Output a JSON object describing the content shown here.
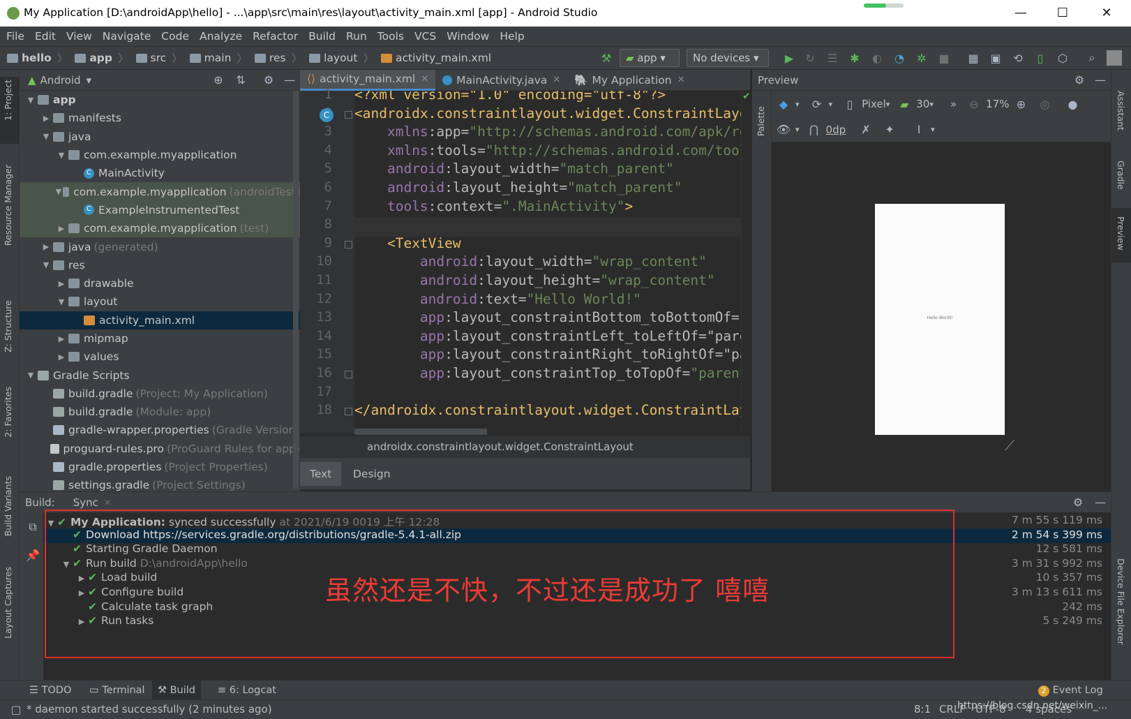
{
  "window": {
    "title": "My Application [D:\\androidApp\\hello] - ...\\app\\src\\main\\res\\layout\\activity_main.xml [app] - Android Studio",
    "minimize": "—",
    "maximize": "☐",
    "close": "✕"
  },
  "menu": [
    "File",
    "Edit",
    "View",
    "Navigate",
    "Code",
    "Analyze",
    "Refactor",
    "Build",
    "Run",
    "Tools",
    "VCS",
    "Window",
    "Help"
  ],
  "breadcrumbs": [
    "hello",
    "app",
    "src",
    "main",
    "res",
    "layout",
    "activity_main.xml"
  ],
  "toolbar": {
    "config": "app",
    "devices": "No devices"
  },
  "left_stripe": [
    "1: Project",
    "Resource Manager",
    "Z: Structure",
    "2: Favorites",
    "Build Variants",
    "Layout Captures"
  ],
  "right_stripe": [
    "Assistant",
    "Gradle",
    "Preview",
    "Device File Explorer"
  ],
  "project": {
    "view": "Android",
    "tree": [
      {
        "label": "app",
        "depth": 0,
        "arrow": "▼",
        "icon": "folder",
        "bold": true
      },
      {
        "label": "manifests",
        "depth": 1,
        "arrow": "▶",
        "icon": "folder"
      },
      {
        "label": "java",
        "depth": 1,
        "arrow": "▼",
        "icon": "folder"
      },
      {
        "label": "com.example.myapplication",
        "depth": 2,
        "arrow": "▼",
        "icon": "package"
      },
      {
        "label": "MainActivity",
        "depth": 3,
        "arrow": "",
        "icon": "class"
      },
      {
        "label": "com.example.myapplication",
        "hint": "(androidTest)",
        "depth": 2,
        "arrow": "▼",
        "icon": "package",
        "tint": true
      },
      {
        "label": "ExampleInstrumentedTest",
        "depth": 3,
        "arrow": "",
        "icon": "class",
        "tint": true
      },
      {
        "label": "com.example.myapplication",
        "hint": "(test)",
        "depth": 2,
        "arrow": "▶",
        "icon": "package",
        "tint": true
      },
      {
        "label": "java",
        "hint": "(generated)",
        "depth": 1,
        "arrow": "▶",
        "icon": "folder"
      },
      {
        "label": "res",
        "depth": 1,
        "arrow": "▼",
        "icon": "folder"
      },
      {
        "label": "drawable",
        "depth": 2,
        "arrow": "▶",
        "icon": "folder"
      },
      {
        "label": "layout",
        "depth": 2,
        "arrow": "▼",
        "icon": "folder"
      },
      {
        "label": "activity_main.xml",
        "depth": 3,
        "arrow": "",
        "icon": "xml",
        "selected": true
      },
      {
        "label": "mipmap",
        "depth": 2,
        "arrow": "▶",
        "icon": "folder"
      },
      {
        "label": "values",
        "depth": 2,
        "arrow": "▶",
        "icon": "folder"
      },
      {
        "label": "Gradle Scripts",
        "depth": 0,
        "arrow": "▼",
        "icon": "gradle"
      },
      {
        "label": "build.gradle",
        "hint": "(Project: My Application)",
        "depth": 1,
        "arrow": "",
        "icon": "gradle"
      },
      {
        "label": "build.gradle",
        "hint": "(Module: app)",
        "depth": 1,
        "arrow": "",
        "icon": "gradle"
      },
      {
        "label": "gradle-wrapper.properties",
        "hint": "(Gradle Version)",
        "depth": 1,
        "arrow": "",
        "icon": "props"
      },
      {
        "label": "proguard-rules.pro",
        "hint": "(ProGuard Rules for app)",
        "depth": 1,
        "arrow": "",
        "icon": "file"
      },
      {
        "label": "gradle.properties",
        "hint": "(Project Properties)",
        "depth": 1,
        "arrow": "",
        "icon": "props"
      },
      {
        "label": "settings.gradle",
        "hint": "(Project Settings)",
        "depth": 1,
        "arrow": "",
        "icon": "gradle"
      }
    ]
  },
  "editor_tabs": [
    {
      "label": "activity_main.xml",
      "active": true
    },
    {
      "label": "MainActivity.java",
      "active": false
    },
    {
      "label": "My Application",
      "active": false
    }
  ],
  "code_lines": [
    {
      "n": "1",
      "parts": [
        [
          "t-pi",
          "<?xml version=\"1.0\" encoding=\"utf-8\"?>"
        ]
      ]
    },
    {
      "n": "2",
      "parts": [
        [
          "t-tag",
          "<androidx.constraintlayout.widget.ConstraintLayout"
        ]
      ]
    },
    {
      "n": "3",
      "parts": [
        [
          "t-attr",
          "    "
        ],
        [
          "t-ns",
          "xmlns"
        ],
        [
          "t-attr",
          ":app="
        ],
        [
          "t-val",
          "\"http://schemas.android.com/apk/res-auto\""
        ]
      ]
    },
    {
      "n": "4",
      "parts": [
        [
          "t-attr",
          "    "
        ],
        [
          "t-ns",
          "xmlns"
        ],
        [
          "t-attr",
          ":tools="
        ],
        [
          "t-val",
          "\"http://schemas.android.com/tools\""
        ]
      ]
    },
    {
      "n": "5",
      "parts": [
        [
          "t-attr",
          "    "
        ],
        [
          "t-ns",
          "android"
        ],
        [
          "t-attr",
          ":layout_width="
        ],
        [
          "t-val",
          "\"match_parent\""
        ]
      ]
    },
    {
      "n": "6",
      "parts": [
        [
          "t-attr",
          "    "
        ],
        [
          "t-ns",
          "android"
        ],
        [
          "t-attr",
          ":layout_height="
        ],
        [
          "t-val",
          "\"match_parent\""
        ]
      ]
    },
    {
      "n": "7",
      "parts": [
        [
          "t-attr",
          "    "
        ],
        [
          "t-ns",
          "tools"
        ],
        [
          "t-attr",
          ":context="
        ],
        [
          "t-val",
          "\".MainActivity\""
        ],
        [
          "t-tag",
          ">"
        ]
      ]
    },
    {
      "n": "8",
      "parts": []
    },
    {
      "n": "9",
      "parts": [
        [
          "t-attr",
          "    "
        ],
        [
          "t-tag",
          "<TextView"
        ]
      ]
    },
    {
      "n": "10",
      "parts": [
        [
          "t-attr",
          "        "
        ],
        [
          "t-ns",
          "android"
        ],
        [
          "t-attr",
          ":layout_width="
        ],
        [
          "t-val",
          "\"wrap_content\""
        ]
      ]
    },
    {
      "n": "11",
      "parts": [
        [
          "t-attr",
          "        "
        ],
        [
          "t-ns",
          "android"
        ],
        [
          "t-attr",
          ":layout_height="
        ],
        [
          "t-val",
          "\"wrap_content\""
        ]
      ]
    },
    {
      "n": "12",
      "parts": [
        [
          "t-attr",
          "        "
        ],
        [
          "t-ns",
          "android"
        ],
        [
          "t-attr",
          ":text="
        ],
        [
          "t-val",
          "\"Hello World!\""
        ]
      ]
    },
    {
      "n": "13",
      "parts": [
        [
          "t-attr",
          "        "
        ],
        [
          "t-ns",
          "app"
        ],
        [
          "t-attr",
          ":layout_constraintBottom_toBottomOf=\"parent\""
        ]
      ]
    },
    {
      "n": "14",
      "parts": [
        [
          "t-attr",
          "        "
        ],
        [
          "t-ns",
          "app"
        ],
        [
          "t-attr",
          ":layout_constraintLeft_toLeftOf=\"parent\""
        ]
      ]
    },
    {
      "n": "15",
      "parts": [
        [
          "t-attr",
          "        "
        ],
        [
          "t-ns",
          "app"
        ],
        [
          "t-attr",
          ":layout_constraintRight_toRightOf=\"parent\""
        ]
      ]
    },
    {
      "n": "16",
      "parts": [
        [
          "t-attr",
          "        "
        ],
        [
          "t-ns",
          "app"
        ],
        [
          "t-attr",
          ":layout_constraintTop_toTopOf="
        ],
        [
          "t-val",
          "\"parent\" />"
        ]
      ]
    },
    {
      "n": "17",
      "parts": []
    },
    {
      "n": "18",
      "parts": [
        [
          "t-tag",
          "</androidx.constraintlayout.widget.ConstraintLayout>"
        ]
      ]
    }
  ],
  "editor_breadcrumb": "androidx.constraintlayout.widget.ConstraintLayout",
  "editor_bottom_tabs": [
    "Text",
    "Design"
  ],
  "preview": {
    "title": "Preview",
    "palette_label": "Palette",
    "device": "Pixel",
    "api": "30",
    "zoom": "17%",
    "margin": "0dp",
    "phone_text": "Hello World!"
  },
  "build": {
    "label": "Build:",
    "tab": "Sync",
    "rows": [
      {
        "text": "My Application:",
        "text2": " synced successfully",
        "hint": " at 2021/6/19 0019 上午 12:28",
        "time": "7 m 55 s 119 ms",
        "indent": 0,
        "arrow": "▼",
        "bold": true
      },
      {
        "text": "Download https://services.gradle.org/distributions/gradle-5.4.1-all.zip",
        "time": "2 m 54 s 399 ms",
        "indent": 1,
        "arrow": "",
        "selected": true
      },
      {
        "text": "Starting Gradle Daemon",
        "time": "12 s 581 ms",
        "indent": 1,
        "arrow": ""
      },
      {
        "text": "Run build",
        "hint": " D:\\androidApp\\hello",
        "time": "3 m 31 s 992 ms",
        "indent": 1,
        "arrow": "▼"
      },
      {
        "text": "Load build",
        "time": "10 s 357 ms",
        "indent": 2,
        "arrow": "▶"
      },
      {
        "text": "Configure build",
        "time": "3 m 13 s 611 ms",
        "indent": 2,
        "arrow": "▶"
      },
      {
        "text": "Calculate task graph",
        "time": "242 ms",
        "indent": 2,
        "arrow": ""
      },
      {
        "text": "Run tasks",
        "time": "5 s 249 ms",
        "indent": 2,
        "arrow": "▶"
      }
    ],
    "annotation": "虽然还是不快，不过还是成功了 嘻嘻"
  },
  "bottom_tabs": [
    "TODO",
    "Terminal",
    "Build",
    "6: Logcat"
  ],
  "event_log": {
    "count": "2",
    "label": "Event Log"
  },
  "status": {
    "message": "* daemon started successfully (2 minutes ago)",
    "position": "8:1",
    "line_sep": "CRLF",
    "encoding": "UTF-8",
    "indent": "4 spaces",
    "watermark": "https://blog.csdn.net/weixin_..."
  },
  "colors": {
    "accent": "#4a88c7",
    "success": "#5ab65a",
    "annotation": "#e0302d"
  }
}
